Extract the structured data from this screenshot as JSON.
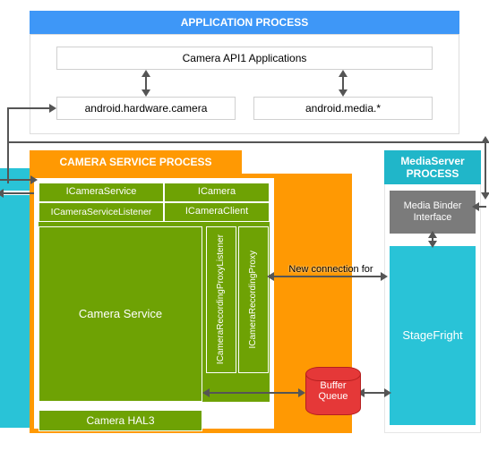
{
  "app_process": {
    "title": "APPLICATION PROCESS",
    "api_apps": "Camera API1 Applications",
    "hw_camera": "android.hardware.camera",
    "media": "android.media.*"
  },
  "camera_service_process": {
    "title": "CAMERA SERVICE PROCESS",
    "icameraservice": "ICameraService",
    "icamera": "ICamera",
    "icameraservicelistener": "ICameraServiceListener",
    "icameraclient": "ICameraClient",
    "camera_service": "Camera Service",
    "rec_proxy_listener": "ICameraRecordingProxyListener",
    "rec_proxy": "ICameraRecordingProxy",
    "camera_hal3": "Camera HAL3"
  },
  "mediaserver_process": {
    "title": "MediaServer PROCESS",
    "binder": "Media Binder Interface",
    "stagefright": "StageFright"
  },
  "buffer_queue": "Buffer Queue",
  "conn_label": "New connection for"
}
